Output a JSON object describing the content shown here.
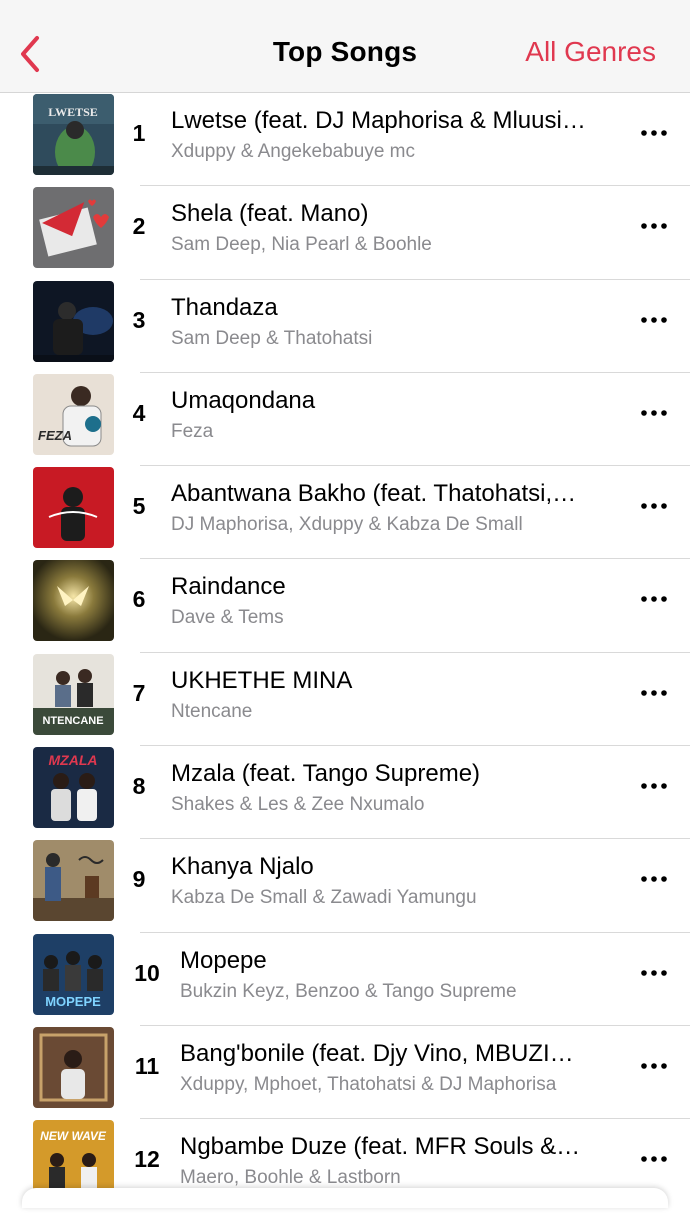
{
  "header": {
    "title": "Top Songs",
    "action_label": "All Genres",
    "back_icon": "chevron-left-icon",
    "accent_color": "#e0384f"
  },
  "songs": [
    {
      "rank": "1",
      "title": "Lwetse (feat. DJ Maphorisa & Mluusi…",
      "artist": "Xduppy & Angekebabuye mc"
    },
    {
      "rank": "2",
      "title": "Shela (feat. Mano)",
      "artist": "Sam Deep, Nia Pearl & Boohle"
    },
    {
      "rank": "3",
      "title": "Thandaza",
      "artist": "Sam Deep & Thatohatsi"
    },
    {
      "rank": "4",
      "title": "Umaqondana",
      "artist": "Feza"
    },
    {
      "rank": "5",
      "title": "Abantwana Bakho (feat. Thatohatsi,…",
      "artist": "DJ Maphorisa, Xduppy & Kabza De Small"
    },
    {
      "rank": "6",
      "title": "Raindance",
      "artist": "Dave & Tems"
    },
    {
      "rank": "7",
      "title": "UKHETHE MINA",
      "artist": "Ntencane"
    },
    {
      "rank": "8",
      "title": "Mzala (feat. Tango Supreme)",
      "artist": "Shakes & Les & Zee Nxumalo"
    },
    {
      "rank": "9",
      "title": "Khanya Njalo",
      "artist": "Kabza De Small & Zawadi Yamungu"
    },
    {
      "rank": "10",
      "title": "Mopepe",
      "artist": "Bukzin Keyz, Benzoo & Tango Supreme"
    },
    {
      "rank": "11",
      "title": "Bang'bonile (feat. Djy Vino, MBUZI…",
      "artist": "Xduppy, Mphoet, Thatohatsi & DJ Maphorisa"
    },
    {
      "rank": "12",
      "title": "Ngbambe Duze (feat. MFR Souls &…",
      "artist": "Maero, Boohle & Lastborn"
    }
  ],
  "artwork_text": {
    "a1": "LWETSE",
    "a4": "FEZA",
    "a7": "NTENCANE",
    "a8": "MZALA",
    "a10": "MOPEPE",
    "a12": "NEW WAVE"
  },
  "more_icon": "ellipsis-icon"
}
